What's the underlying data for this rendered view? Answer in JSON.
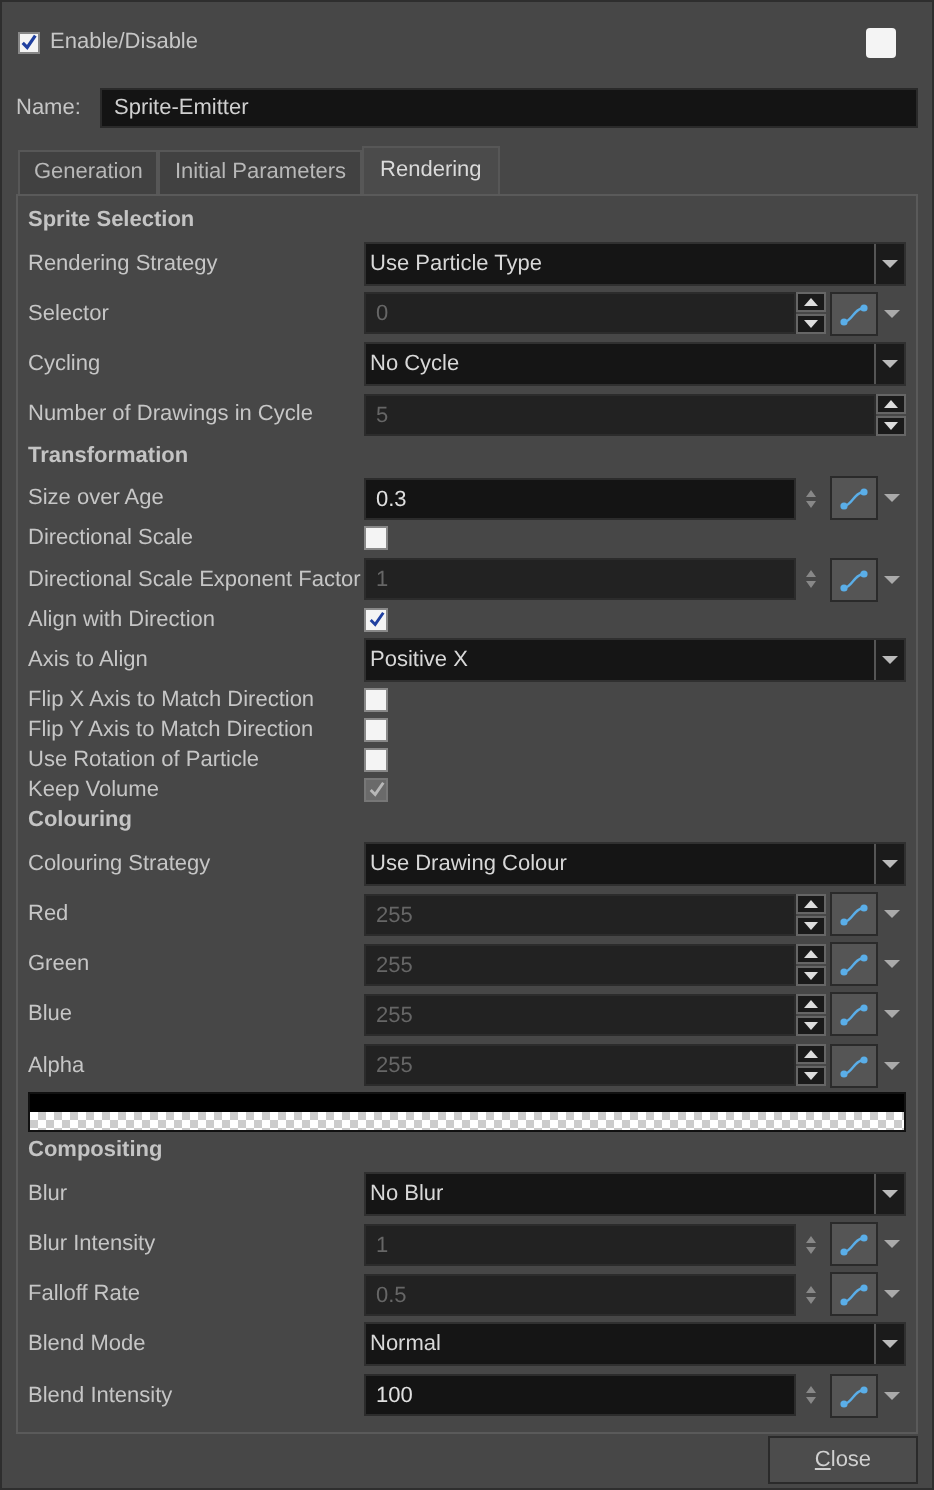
{
  "enable": {
    "label": "Enable/Disable",
    "checked": true
  },
  "enable_right": {
    "checked": false
  },
  "name": {
    "label": "Name:",
    "value": "Sprite-Emitter"
  },
  "tabs": [
    {
      "label": "Generation",
      "selected": false
    },
    {
      "label": "Initial Parameters",
      "selected": false
    },
    {
      "label": "Rendering",
      "selected": true
    }
  ],
  "rows": [
    {
      "kind": "header",
      "label": "Sprite Selection"
    },
    {
      "kind": "dropdown",
      "label": "Rendering Strategy",
      "value": "Use Particle Type"
    },
    {
      "kind": "stepper",
      "label": "Selector",
      "value": "0",
      "disabled": true,
      "curve_button": true
    },
    {
      "kind": "dropdown",
      "label": "Cycling",
      "value": "No Cycle"
    },
    {
      "kind": "stepper",
      "label": "Number of Drawings in Cycle",
      "value": "5",
      "disabled": true,
      "curve_button": false
    },
    {
      "kind": "header",
      "label": "Transformation"
    },
    {
      "kind": "number",
      "label": "Size over Age",
      "value": "0.3",
      "disabled": false,
      "curve_button": true
    },
    {
      "kind": "checkbox",
      "label": "Directional Scale",
      "checked": false,
      "disabled": false
    },
    {
      "kind": "number",
      "label": "Directional Scale Exponent Factor",
      "value": "1",
      "disabled": true,
      "curve_button": true
    },
    {
      "kind": "checkbox",
      "label": "Align with Direction",
      "checked": true,
      "disabled": false
    },
    {
      "kind": "dropdown",
      "label": "Axis to Align",
      "value": "Positive X"
    },
    {
      "kind": "checkbox",
      "label": "Flip X Axis to Match Direction",
      "checked": false,
      "disabled": false
    },
    {
      "kind": "checkbox",
      "label": "Flip Y Axis to Match Direction",
      "checked": false,
      "disabled": false
    },
    {
      "kind": "checkbox",
      "label": "Use Rotation of Particle",
      "checked": false,
      "disabled": false
    },
    {
      "kind": "checkbox",
      "label": "Keep Volume",
      "checked": true,
      "disabled": true
    },
    {
      "kind": "header",
      "label": "Colouring"
    },
    {
      "kind": "dropdown",
      "label": "Colouring Strategy",
      "value": "Use Drawing Colour"
    },
    {
      "kind": "stepper",
      "label": "Red",
      "value": "255",
      "disabled": true,
      "curve_button": true
    },
    {
      "kind": "stepper",
      "label": "Green",
      "value": "255",
      "disabled": true,
      "curve_button": true
    },
    {
      "kind": "stepper",
      "label": "Blue",
      "value": "255",
      "disabled": true,
      "curve_button": true
    },
    {
      "kind": "stepper",
      "label": "Alpha",
      "value": "255",
      "disabled": true,
      "curve_button": true
    },
    {
      "kind": "swatch"
    },
    {
      "kind": "header",
      "label": "Compositing"
    },
    {
      "kind": "dropdown",
      "label": "Blur",
      "value": "No Blur"
    },
    {
      "kind": "number",
      "label": "Blur Intensity",
      "value": "1",
      "disabled": true,
      "curve_button": true
    },
    {
      "kind": "number",
      "label": "Falloff Rate",
      "value": "0.5",
      "disabled": true,
      "curve_button": true
    },
    {
      "kind": "dropdown",
      "label": "Blend Mode",
      "value": "Normal"
    },
    {
      "kind": "number",
      "label": "Blend Intensity",
      "value": "100",
      "disabled": false,
      "curve_button": true
    }
  ],
  "close_button": "Close"
}
